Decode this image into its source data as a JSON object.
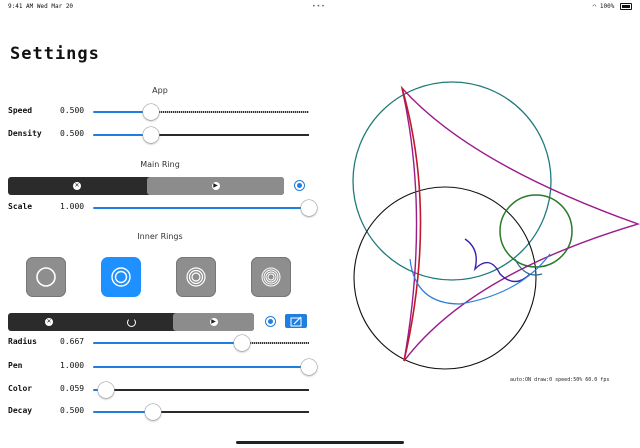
{
  "status_bar": {
    "time": "9:41 AM",
    "date": "Wed Mar 20",
    "center_dots": "•••",
    "battery": "100%"
  },
  "title": "Settings",
  "sections": {
    "app": "App",
    "main_ring": "Main Ring",
    "inner_rings": "Inner Rings"
  },
  "app_sliders": [
    {
      "label": "Speed",
      "value": "0.500",
      "fraction": 0.27
    },
    {
      "label": "Density",
      "value": "0.500",
      "fraction": 0.27
    }
  ],
  "main_ring": {
    "segments": [
      {
        "icon": "close-icon"
      },
      {
        "icon": "play-icon"
      }
    ],
    "selected_index": 1,
    "scale": {
      "label": "Scale",
      "value": "1.000",
      "fraction": 1.0
    }
  },
  "inner_rings": {
    "ring_buttons": [
      {
        "name": "ring-style-single",
        "rings": 1
      },
      {
        "name": "ring-style-double",
        "rings": 2
      },
      {
        "name": "ring-style-triple",
        "rings": 3
      },
      {
        "name": "ring-style-quad",
        "rings": 4
      }
    ],
    "selected_ring_button": 1,
    "segments": [
      {
        "icon": "close-icon"
      },
      {
        "icon": "refresh-icon"
      },
      {
        "icon": "play-icon"
      }
    ],
    "selected_index": 2,
    "sliders": [
      {
        "label": "Radius",
        "value": "0.667",
        "fraction": 0.69
      },
      {
        "label": "Pen",
        "value": "1.000",
        "fraction": 1.0
      },
      {
        "label": "Color",
        "value": "0.059",
        "fraction": 0.06
      },
      {
        "label": "Decay",
        "value": "0.500",
        "fraction": 0.28
      }
    ]
  },
  "canvas_status": "auto:ON  draw:0  speed:50%  60.0 fps",
  "colors": {
    "accent": "#1e7fe0",
    "selected_tile": "#1e90ff",
    "tile": "#8e8e8e"
  }
}
